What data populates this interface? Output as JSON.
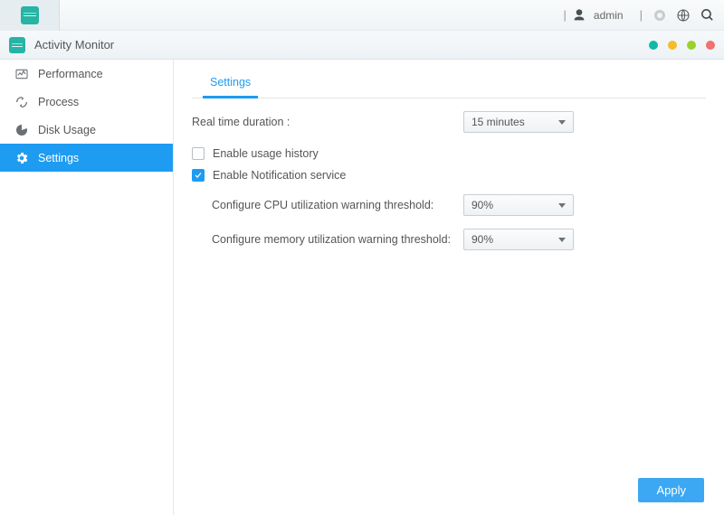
{
  "sysbar": {
    "user_label": "admin"
  },
  "titlebar": {
    "title": "Activity Monitor",
    "dots": [
      "#14b8a6",
      "#f5bc2c",
      "#9bd12e",
      "#f0716d"
    ]
  },
  "sidebar": {
    "items": [
      {
        "label": "Performance"
      },
      {
        "label": "Process"
      },
      {
        "label": "Disk Usage"
      },
      {
        "label": "Settings"
      }
    ]
  },
  "tabs": {
    "settings": "Settings"
  },
  "form": {
    "realtime_label": "Real time duration :",
    "realtime_value": "15 minutes",
    "enable_history_label": "Enable usage history",
    "enable_notify_label": "Enable Notification service",
    "cpu_threshold_label": "Configure CPU utilization warning threshold:",
    "cpu_threshold_value": "90%",
    "mem_threshold_label": "Configure memory utilization warning threshold:",
    "mem_threshold_value": "90%"
  },
  "buttons": {
    "apply": "Apply"
  }
}
